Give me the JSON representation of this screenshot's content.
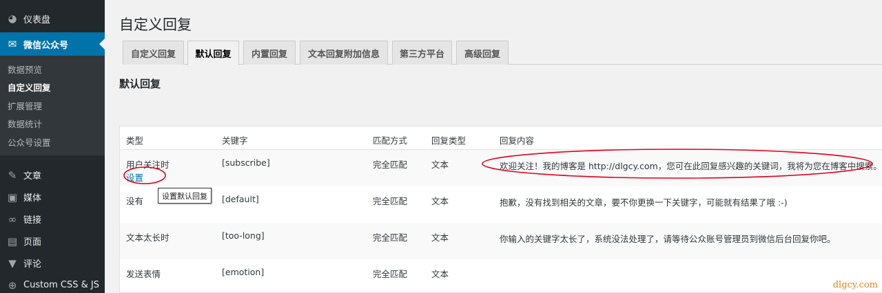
{
  "sidebar": {
    "items": [
      {
        "label": "仪表盘",
        "icon": "dashboard-icon"
      },
      {
        "label": "微信公众号",
        "icon": "wechat-icon",
        "current": true
      }
    ],
    "submenu": [
      {
        "label": "数据预览"
      },
      {
        "label": "自定义回复",
        "active": true
      },
      {
        "label": "扩展管理"
      },
      {
        "label": "数据统计"
      },
      {
        "label": "公众号设置"
      }
    ],
    "items_after": [
      {
        "label": "文章",
        "icon": "pin-icon"
      },
      {
        "label": "媒体",
        "icon": "media-icon"
      },
      {
        "label": "链接",
        "icon": "link-icon"
      },
      {
        "label": "页面",
        "icon": "page-icon"
      },
      {
        "label": "评论",
        "icon": "comment-icon"
      },
      {
        "label": "Custom CSS & JS",
        "icon": "plus-circle-icon"
      }
    ]
  },
  "page": {
    "title": "自定义回复",
    "section_title": "默认回复"
  },
  "tabs": [
    {
      "label": "自定义回复"
    },
    {
      "label": "默认回复",
      "active": true
    },
    {
      "label": "内置回复"
    },
    {
      "label": "文本回复附加信息"
    },
    {
      "label": "第三方平台"
    },
    {
      "label": "高级回复"
    }
  ],
  "table": {
    "headers": [
      "类型",
      "关键字",
      "匹配方式",
      "回复类型",
      "回复内容"
    ],
    "rows": [
      {
        "type": "用户关注时",
        "action": "设置",
        "keyword": "[subscribe]",
        "match": "完全匹配",
        "reply_type": "文本",
        "content": "欢迎关注！我的博客是 http://dlgcy.com，您可在此回复感兴趣的关键词，我将为您在博客中搜索。"
      },
      {
        "type": "没有",
        "keyword": "[default]",
        "match": "完全匹配",
        "reply_type": "文本",
        "content": "抱歉，没有找到相关的文章，要不你更换一下关键字，可能就有结果了哦 :-)"
      },
      {
        "type": "文本太长时",
        "keyword": "[too-long]",
        "match": "完全匹配",
        "reply_type": "文本",
        "content": "你输入的关键字太长了，系统没法处理了，请等待公众账号管理员到微信后台回复你吧。"
      },
      {
        "type": "发送表情",
        "keyword": "[emotion]",
        "match": "完全匹配",
        "reply_type": "文本",
        "content": ""
      }
    ],
    "tooltip": "设置默认回复"
  },
  "watermark": "dlgcy.com",
  "colors": {
    "sidebar_bg": "#23282d",
    "accent": "#0073aa",
    "annotation": "#e2001a"
  }
}
